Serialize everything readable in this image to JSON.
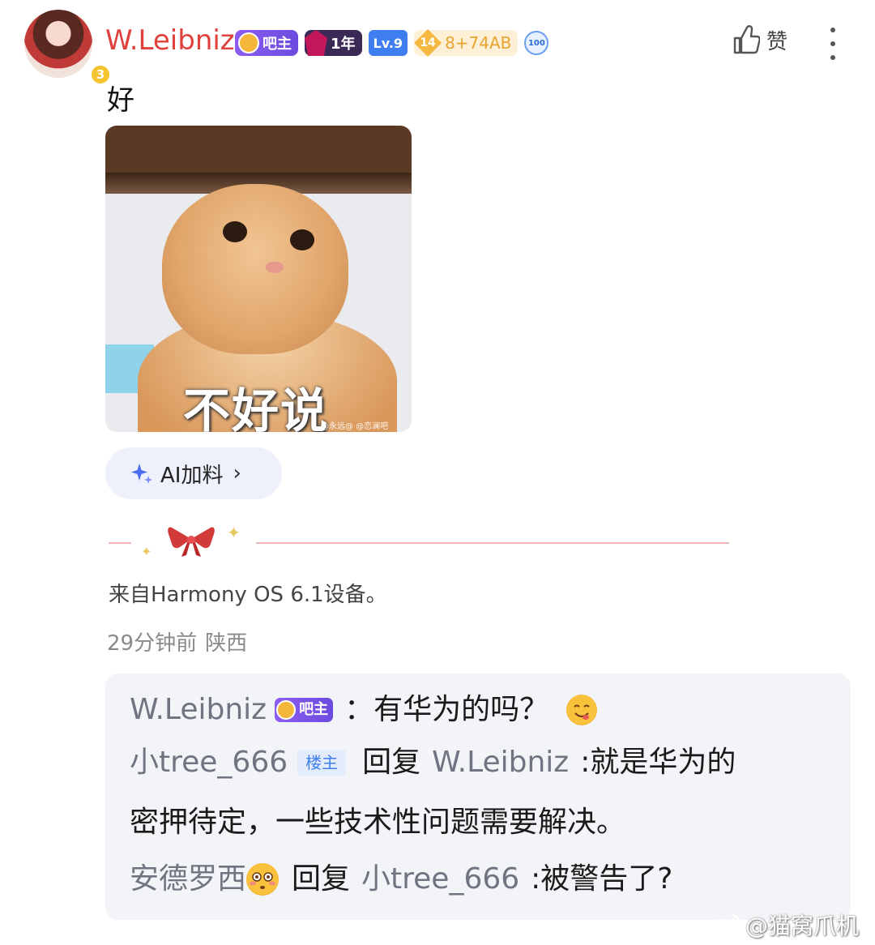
{
  "post": {
    "author": {
      "name": "W.Leibniz",
      "avatar_level": "3",
      "badges": {
        "admin": "吧主",
        "years": "1年",
        "level": "Lv.9",
        "gold_level": "14",
        "gold_value": "8+74AB",
        "calendar": "100"
      }
    },
    "like_label": "赞",
    "text": "好",
    "image": {
      "caption": "不好说",
      "watermark": "@永远@ @恋澜吧"
    },
    "ai_button": {
      "label": "AI加料",
      "chevron": "›"
    },
    "device": "来自Harmony OS 6.1设备。",
    "time": "29分钟前",
    "location": "陕西"
  },
  "replies": [
    {
      "name": "W.Leibniz",
      "badge": "吧主",
      "text": "：有华为的吗？",
      "emoji": "yum-emoji-icon"
    },
    {
      "name": "小tree_666",
      "badge": "楼主",
      "verb": "回复",
      "target": "W.Leibniz",
      "text": ":就是华为的",
      "continuation": "密押待定，一些技术性问题需要解决。"
    },
    {
      "name": "安德罗西",
      "emoji": "flushed-emoji-icon",
      "verb": "回复",
      "target": "小tree_666",
      "text": ":被警告了?"
    }
  ],
  "watermark": "@猫窝爪机",
  "colors": {
    "username": "#e0413d",
    "reply_name": "#6f7480",
    "reply_bg": "#f3f4f7",
    "ai_button_bg": "#eef0fb",
    "op_badge": "#3f7ef0"
  }
}
